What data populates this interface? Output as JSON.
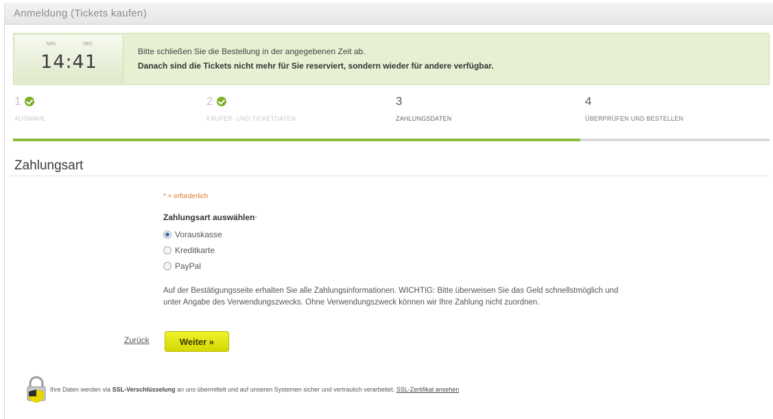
{
  "header": {
    "title": "Anmeldung (Tickets kaufen)"
  },
  "timer": {
    "min_label": "MIN",
    "sec_label": "SEC",
    "time": "14:41",
    "message": "Bitte schließen Sie die Bestellung in der angegebenen Zeit ab.",
    "warning": "Danach sind die Tickets nicht mehr für Sie reserviert, sondern wieder für andere verfügbar."
  },
  "steps": [
    {
      "number": "1",
      "label": "AUSWAHL",
      "status": "done"
    },
    {
      "number": "2",
      "label": "KÄUFER- UND TICKETDATEN",
      "status": "done"
    },
    {
      "number": "3",
      "label": "ZAHLUNGSDATEN",
      "status": "active"
    },
    {
      "number": "4",
      "label": "ÜBERPRÜFEN UND BESTELLEN",
      "status": "todo"
    }
  ],
  "progress": {
    "completed_fraction": 0.75
  },
  "section": {
    "title": "Zahlungsart"
  },
  "form": {
    "required_note": "* = erforderlich",
    "field_label": "Zahlungsart auswählen",
    "required_marker": "*",
    "options": [
      {
        "label": "Vorauskasse",
        "checked": true
      },
      {
        "label": "Kreditkarte",
        "checked": false
      },
      {
        "label": "PayPal",
        "checked": false
      }
    ],
    "info_text": "Auf der Bestätigungsseite erhalten Sie alle Zahlungsinformationen. WICHTIG: Bitte überweisen Sie das Geld schnellstmöglich und unter Angabe des Verwendungszwecks. Ohne Verwendungszweck können wir Ihre Zahlung nicht zuordnen."
  },
  "actions": {
    "back_label": "Zurück",
    "next_label": "Weiter »"
  },
  "footer": {
    "ssl_prefix": "Ihre Daten werden via",
    "ssl_bold": "SSL-Verschlüsselung",
    "ssl_suffix": "an uns übermittelt und auf unseren Systemen sicher und vertraulich verarbeitet.",
    "ssl_link": "SSL-Zertifikat ansehen"
  },
  "colors": {
    "accent_green": "#8cbb3a",
    "button_yellow": "#dfe300",
    "required_orange": "#e07b2a",
    "timer_bg": "#e7f0d3"
  },
  "icons": {
    "step_done": "check-circle-icon",
    "radio": "radio-icon",
    "ssl": "padlock-shield-icon"
  }
}
